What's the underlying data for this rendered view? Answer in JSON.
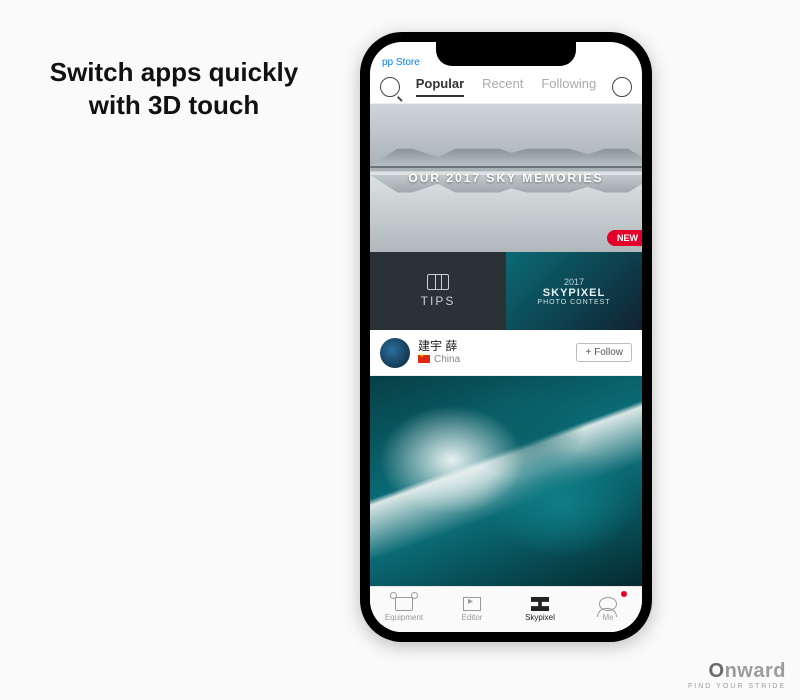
{
  "headline": "Switch apps quickly with 3D touch",
  "statusbar": {
    "back_label": "pp Store"
  },
  "topnav": {
    "tabs": [
      {
        "label": "Popular",
        "active": true
      },
      {
        "label": "Recent",
        "active": false
      },
      {
        "label": "Following",
        "active": false
      }
    ]
  },
  "hero": {
    "title": "OUR 2017 SKY MEMORIES",
    "badge": "NEW"
  },
  "row2": {
    "tips_label": "TIPS",
    "contest": {
      "year": "2017",
      "line1": "SKYPIXEL",
      "line2": "PHOTO CONTEST"
    }
  },
  "user": {
    "name": "建宇 薛",
    "location": "China",
    "follow_label": "Follow"
  },
  "tabbar": {
    "items": [
      {
        "label": "Equipment"
      },
      {
        "label": "Editor"
      },
      {
        "label": "Skypixel"
      },
      {
        "label": "Me"
      }
    ],
    "active_index": 2,
    "notification_index": 3
  },
  "brand": {
    "name_prefix": "O",
    "name_rest": "nward",
    "tagline": "FIND YOUR STRIDE"
  }
}
